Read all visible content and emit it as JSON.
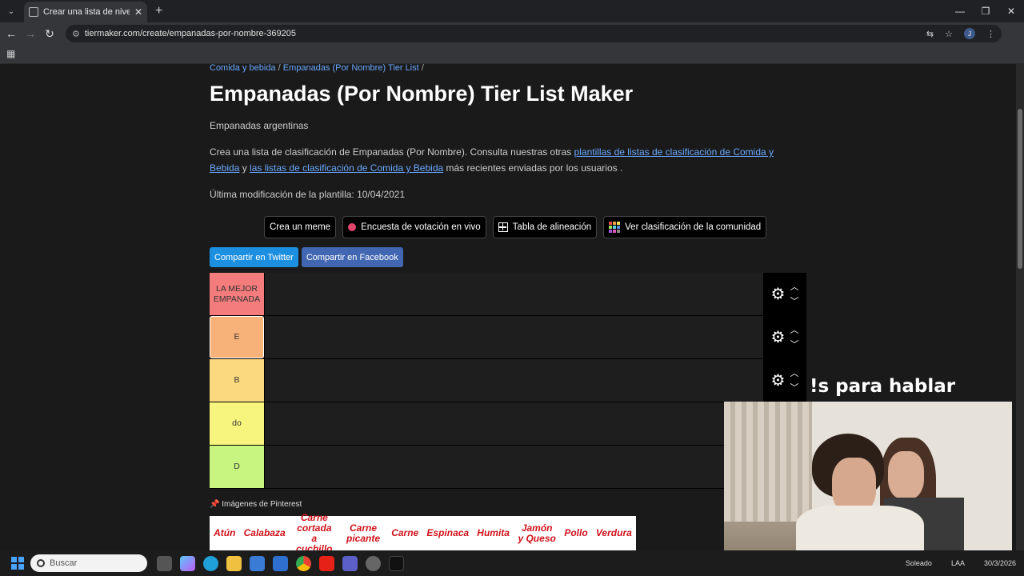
{
  "browser": {
    "tab_title": "Crear una lista de niveles de em",
    "url": "tiermaker.com/create/empanadas-por-nombre-369205",
    "avatar_letter": "J"
  },
  "page": {
    "breadcrumb_1": "Comida y bebida",
    "breadcrumb_sep_1": " / ",
    "breadcrumb_2": "Empanadas (Por Nombre) Tier List",
    "breadcrumb_sep_2": " /",
    "title": "Empanadas (Por Nombre) Tier List Maker",
    "subtitle": "Empanadas argentinas",
    "desc_1": "Crea una lista de clasificación de Empanadas (Por Nombre). Consulta nuestras otras ",
    "desc_link_1": "plantillas de listas de clasificación de Comida y Bebida",
    "desc_2": " y ",
    "desc_link_2": "las listas de clasificación de Comida y Bebida",
    "desc_3": " más recientes enviadas por los usuarios .",
    "modified": "Última modificación de la plantilla: 10/04/2021"
  },
  "actions": {
    "meme": "Crea un meme",
    "poll": "Encuesta de votación en vivo",
    "alignment": "Tabla de alineación",
    "community": "Ver clasificación de la comunidad"
  },
  "share": {
    "twitter": "Compartir en Twitter",
    "facebook": "Compartir en Facebook"
  },
  "tiers": [
    {
      "label": "LA MEJOR EMPANADA",
      "color": "#f47c7c"
    },
    {
      "label": "E",
      "color": "#f7b27a"
    },
    {
      "label": "B",
      "color": "#fbd97f"
    },
    {
      "label": "do",
      "color": "#f8f57f"
    },
    {
      "label": "D",
      "color": "#c7f57f"
    }
  ],
  "pinterest": {
    "label": "Imágenes de Pinterest",
    "items": [
      "Atún",
      "Calabaza",
      "Carne cortada a cuchillo",
      "Carne picante",
      "Carne",
      "Espinaca",
      "Humita",
      "Jamón y Queso",
      "Pollo",
      "Verdura"
    ]
  },
  "overlay": {
    "text": "!s para hablar"
  },
  "taskbar": {
    "search_placeholder": "Buscar",
    "weather": "Soleado",
    "lang": "LAA",
    "date": "30/3/2026"
  }
}
